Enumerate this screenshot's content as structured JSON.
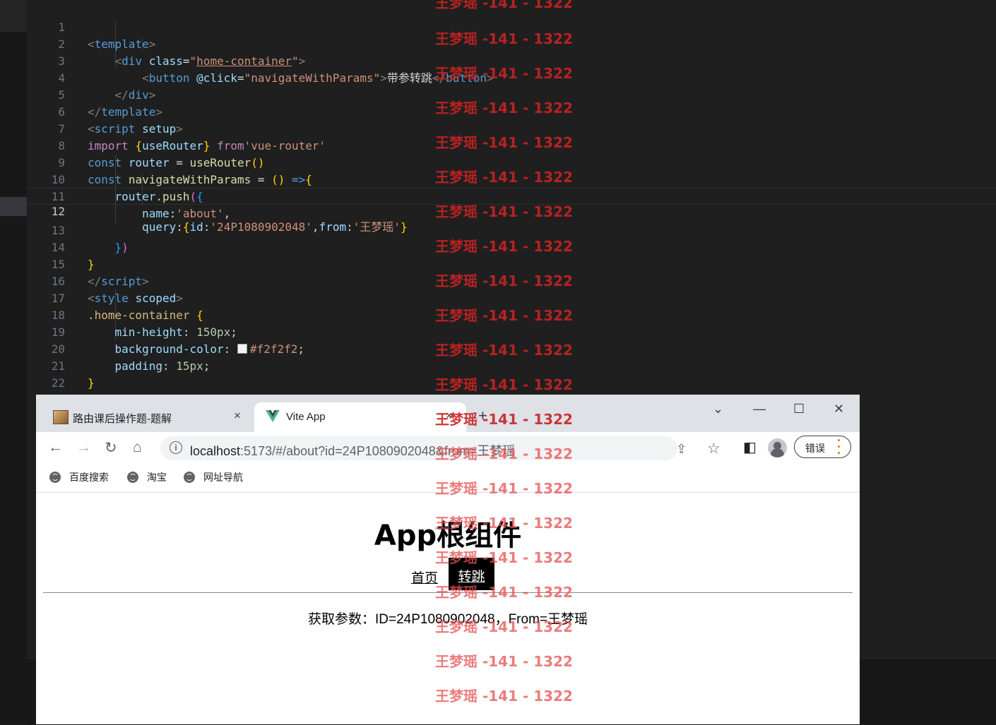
{
  "editor": {
    "lines": [
      {
        "n": "1"
      },
      {
        "n": "2"
      },
      {
        "n": "3"
      },
      {
        "n": "4"
      },
      {
        "n": "5"
      },
      {
        "n": "6"
      },
      {
        "n": "7"
      },
      {
        "n": "8"
      },
      {
        "n": "9"
      },
      {
        "n": "10"
      },
      {
        "n": "11"
      },
      {
        "n": "12"
      },
      {
        "n": "13"
      },
      {
        "n": "14"
      },
      {
        "n": "15"
      },
      {
        "n": "16"
      },
      {
        "n": "17"
      },
      {
        "n": "18"
      },
      {
        "n": "19"
      },
      {
        "n": "20"
      },
      {
        "n": "21"
      },
      {
        "n": "22"
      }
    ],
    "current_line": "12",
    "code": {
      "l1_tag": "template",
      "l2_tag": "div",
      "l2_attr": "class",
      "l2_val": "home-container",
      "l3_tag": "button",
      "l3_attr": "@click",
      "l3_val": "navigateWithParams",
      "l3_text": "带参转跳",
      "l3_close": "button",
      "l4_tag": "div",
      "l5_tag": "template",
      "l6_tag": "script",
      "l6_attr": "setup",
      "l7_kw": "import",
      "l7_name": "useRouter",
      "l7_from": "from",
      "l7_str": "'vue-router'",
      "l8_kw": "const",
      "l8_var": "router",
      "l8_fn": "useRouter",
      "l9_kw": "const",
      "l9_var": "navigateWithParams",
      "l10_obj": "router",
      "l10_fn": "push",
      "l11_key": "name",
      "l11_val": "'about'",
      "l12_key": "query",
      "l12_k1": "id",
      "l12_v1": "'24P1080902048'",
      "l12_k2": "from",
      "l12_v2": "'王梦瑶'",
      "l15_tag": "script",
      "l16_tag": "style",
      "l16_attr": "scoped",
      "l17_sel": ".home-container",
      "l18_prop": "min-height",
      "l18_val": "150px",
      "l19_prop": "background-color",
      "l19_val": "#f2f2f2",
      "l20_prop": "padding",
      "l20_val": "15px",
      "l22_tag": "style"
    }
  },
  "browser": {
    "tabs": [
      {
        "title": "路由课后操作题-题解",
        "close": "×"
      },
      {
        "title": "Vite App",
        "close": "×"
      }
    ],
    "new_tab": "+",
    "window": {
      "minimize": "—",
      "maximize": "☐",
      "close": "✕",
      "dropdown": "⌄"
    },
    "nav": {
      "back": "←",
      "forward": "→",
      "reload": "↻",
      "home": "⌂"
    },
    "url_host": "localhost",
    "url_rest": ":5173/#/about?id=24P1080902048&from=王梦瑶",
    "error_label": "错误",
    "bookmarks": [
      "百度搜索",
      "淘宝",
      "网址导航"
    ],
    "page": {
      "title": "App根组件",
      "nav_home": "首页",
      "nav_jump": "转跳",
      "params_text": "获取参数：ID=24P1080902048，From=王梦瑶"
    }
  },
  "watermark": {
    "text": "王梦瑶 -141 - 1322",
    "color": "#c82222"
  }
}
